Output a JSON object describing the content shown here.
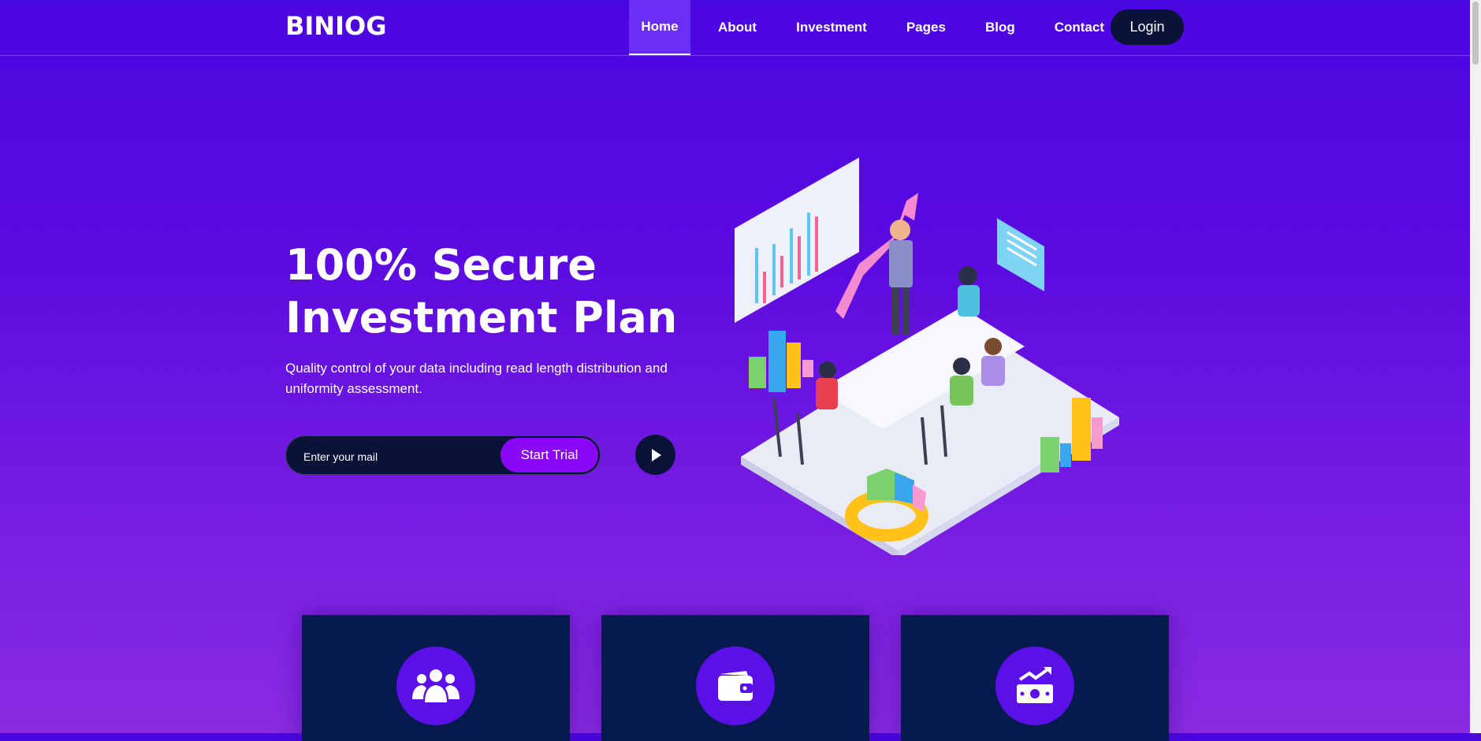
{
  "header": {
    "logo": "BINIOG",
    "nav": [
      {
        "label": "Home",
        "active": true
      },
      {
        "label": "About",
        "active": false
      },
      {
        "label": "Investment",
        "active": false
      },
      {
        "label": "Pages",
        "active": false
      },
      {
        "label": "Blog",
        "active": false
      },
      {
        "label": "Contact",
        "active": false
      }
    ],
    "login_label": "Login"
  },
  "hero": {
    "title_line1": "100% Secure",
    "title_line2": "Investment Plan",
    "subtitle": "Quality control of your data including read length distribution and uniformity assessment.",
    "email_placeholder": "Enter your mail",
    "cta_label": "Start Trial",
    "play_icon": "play-icon"
  },
  "features": [
    {
      "icon": "users-icon"
    },
    {
      "icon": "wallet-icon"
    },
    {
      "icon": "money-growth-icon"
    }
  ],
  "colors": {
    "bg_top": "#4a06e0",
    "bg_bottom": "#8a2be2",
    "dark_navy": "#0a1238",
    "card_bg": "#071a4d",
    "accent_purple": "#8a08f5",
    "active_nav": "#6a2ef5"
  }
}
